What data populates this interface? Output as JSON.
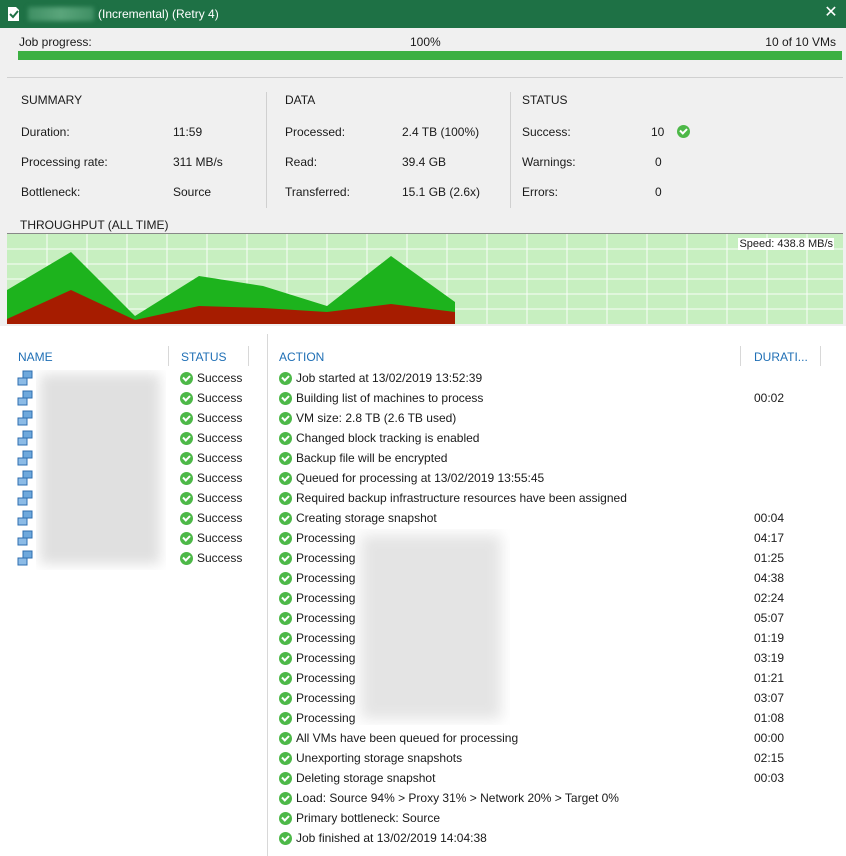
{
  "window": {
    "title_suffix": "(Incremental) (Retry 4)",
    "close_glyph": "✕"
  },
  "progress": {
    "label": "Job progress:",
    "percent_text": "100%",
    "fraction": 1.0,
    "count_text": "10 of 10 VMs"
  },
  "summary": {
    "title": "SUMMARY",
    "rows": [
      {
        "label": "Duration:",
        "value": "11:59"
      },
      {
        "label": "Processing rate:",
        "value": "311 MB/s"
      },
      {
        "label": "Bottleneck:",
        "value": "Source"
      }
    ]
  },
  "data_section": {
    "title": "DATA",
    "rows": [
      {
        "label": "Processed:",
        "value": "2.4 TB (100%)"
      },
      {
        "label": "Read:",
        "value": "39.4 GB"
      },
      {
        "label": "Transferred:",
        "value": "15.1 GB (2.6x)"
      }
    ]
  },
  "status_section": {
    "title": "STATUS",
    "rows": [
      {
        "label": "Success:",
        "value": "10"
      },
      {
        "label": "Warnings:",
        "value": "0"
      },
      {
        "label": "Errors:",
        "value": "0"
      }
    ]
  },
  "throughput": {
    "title": "THROUGHPUT (ALL TIME)",
    "speed_text": "Speed: 438.8 MB/s"
  },
  "vm_table": {
    "headers": {
      "name": "NAME",
      "status": "STATUS"
    },
    "rows": [
      {
        "status": "Success"
      },
      {
        "status": "Success"
      },
      {
        "status": "Success"
      },
      {
        "status": "Success"
      },
      {
        "status": "Success"
      },
      {
        "status": "Success"
      },
      {
        "status": "Success"
      },
      {
        "status": "Success"
      },
      {
        "status": "Success"
      },
      {
        "status": "Success"
      }
    ]
  },
  "action_table": {
    "headers": {
      "action": "ACTION",
      "duration": "DURATI..."
    },
    "rows": [
      {
        "action": "Job started at 13/02/2019 13:52:39",
        "duration": ""
      },
      {
        "action": "Building list of machines to process",
        "duration": "00:02"
      },
      {
        "action": "VM size: 2.8 TB (2.6 TB used)",
        "duration": ""
      },
      {
        "action": "Changed block tracking is enabled",
        "duration": ""
      },
      {
        "action": "Backup file will be encrypted",
        "duration": ""
      },
      {
        "action": "Queued for processing at 13/02/2019 13:55:45",
        "duration": ""
      },
      {
        "action": "Required backup infrastructure resources have been assigned",
        "duration": ""
      },
      {
        "action": "Creating storage snapshot",
        "duration": "00:04"
      },
      {
        "action": "Processing",
        "duration": "04:17"
      },
      {
        "action": "Processing",
        "duration": "01:25"
      },
      {
        "action": "Processing",
        "duration": "04:38"
      },
      {
        "action": "Processing",
        "duration": "02:24"
      },
      {
        "action": "Processing",
        "duration": "05:07"
      },
      {
        "action": "Processing",
        "duration": "01:19"
      },
      {
        "action": "Processing",
        "duration": "03:19"
      },
      {
        "action": "Processing",
        "duration": "01:21"
      },
      {
        "action": "Processing",
        "duration": "03:07"
      },
      {
        "action": "Processing",
        "duration": "01:08"
      },
      {
        "action": "All VMs have been queued for processing",
        "duration": "00:00"
      },
      {
        "action": "Unexporting storage snapshots",
        "duration": "02:15"
      },
      {
        "action": "Deleting storage snapshot",
        "duration": "00:03"
      },
      {
        "action": "Load: Source 94% > Proxy 31% > Network 20% > Target 0%",
        "duration": ""
      },
      {
        "action": "Primary bottleneck: Source",
        "duration": ""
      },
      {
        "action": "Job finished at 13/02/2019 14:04:38",
        "duration": ""
      }
    ]
  },
  "colors": {
    "titlebar": "#1e7145",
    "progress": "#3cb043",
    "chart_bg": "#c7efc0",
    "chart_read": "#1db31d",
    "chart_transfer": "#a61c00",
    "success": "#4db848",
    "header_text": "#1f6fb5"
  },
  "icons": {
    "app": "job-report-icon",
    "vm": "vm-icon",
    "status_ok": "success-check-icon",
    "close": "close-icon"
  }
}
